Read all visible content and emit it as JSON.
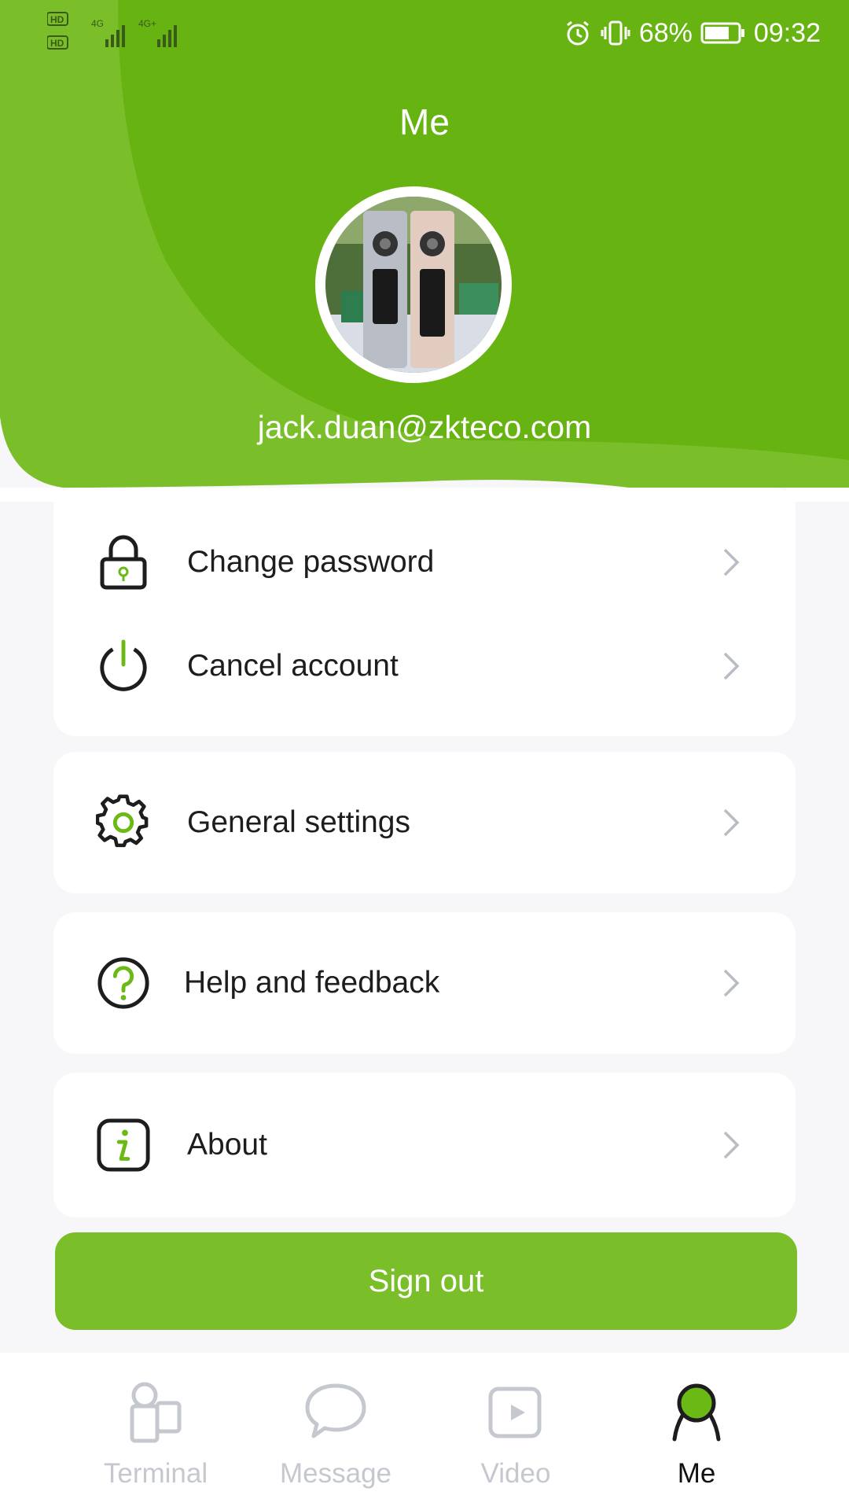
{
  "status_bar": {
    "network_left": "HD 4G 4G+",
    "battery_percent": "68%",
    "time": "09:32",
    "icons": [
      "alarm-icon",
      "vibrate-icon",
      "battery-icon"
    ]
  },
  "header": {
    "title": "Me",
    "email": "jack.duan@zkteco.com"
  },
  "menu": {
    "change_password": "Change password",
    "cancel_account": "Cancel account",
    "general_settings": "General settings",
    "help_feedback": "Help and feedback",
    "about": "About"
  },
  "sign_out_label": "Sign out",
  "tabs": [
    {
      "label": "Terminal",
      "icon": "terminal-icon",
      "active": false
    },
    {
      "label": "Message",
      "icon": "message-icon",
      "active": false
    },
    {
      "label": "Video",
      "icon": "video-icon",
      "active": false
    },
    {
      "label": "Me",
      "icon": "me-icon",
      "active": true
    }
  ],
  "colors": {
    "brand_green": "#6bb915",
    "button_green": "#7abf2a",
    "text_dark": "#1d1d1f",
    "inactive_tab": "#c5c8cf"
  }
}
